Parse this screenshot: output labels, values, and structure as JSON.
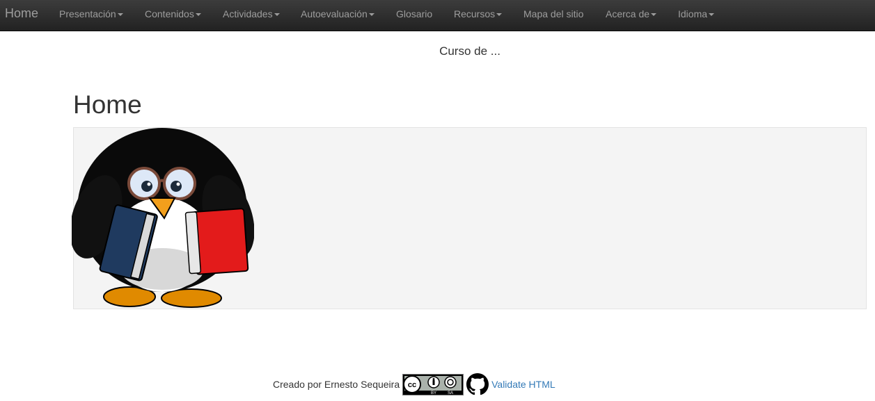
{
  "navbar": {
    "brand": "Home",
    "items": [
      {
        "label": "Presentación",
        "dropdown": true
      },
      {
        "label": "Contenidos",
        "dropdown": true
      },
      {
        "label": "Actividades",
        "dropdown": true
      },
      {
        "label": "Autoevaluación",
        "dropdown": true
      },
      {
        "label": "Glosario",
        "dropdown": false
      },
      {
        "label": "Recursos",
        "dropdown": true
      },
      {
        "label": "Mapa del sitio",
        "dropdown": false
      },
      {
        "label": "Acerca de",
        "dropdown": true
      },
      {
        "label": "Idioma",
        "dropdown": true
      }
    ]
  },
  "header": {
    "course_title": "Curso de ..."
  },
  "main": {
    "title": "Home",
    "image_icon": "tux-penguin-with-books-icon"
  },
  "footer": {
    "created_by": "Creado por Ernesto Sequeira",
    "license_badge": {
      "icon": "cc-by-sa-icon",
      "text_by": "BY",
      "text_sa": "SA"
    },
    "repo_icon": "github-icon",
    "validate_link": "Validate HTML"
  },
  "colors": {
    "navbar_bg": "#222222",
    "nav_text": "#9d9d9d",
    "panel_bg": "#f4f4f4",
    "link": "#337ab7"
  }
}
